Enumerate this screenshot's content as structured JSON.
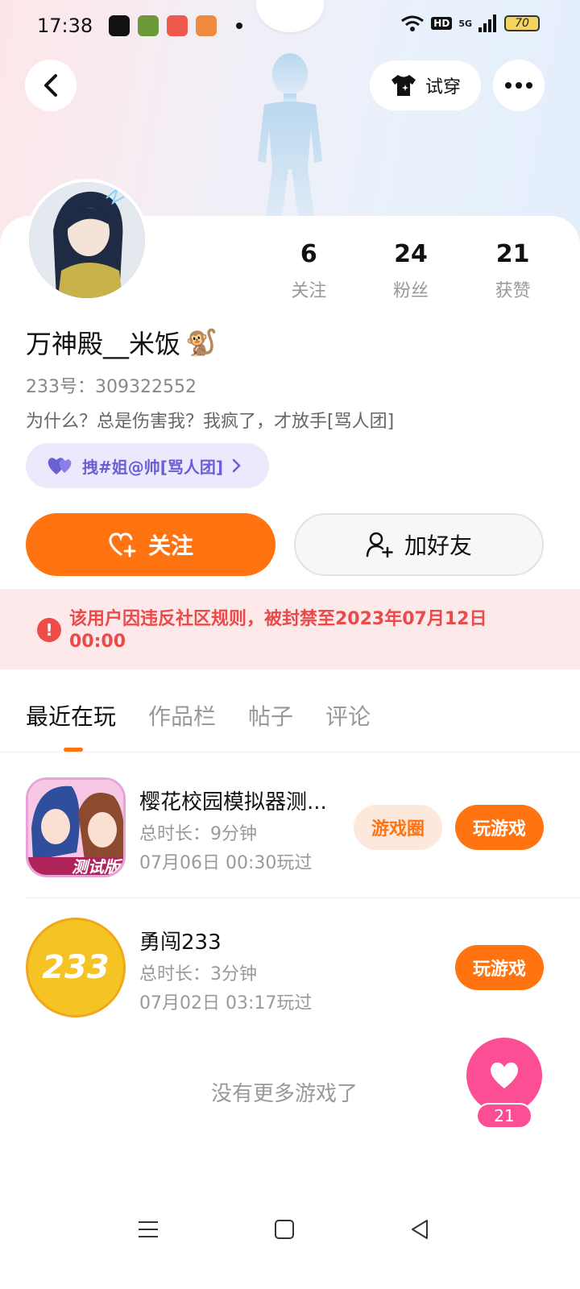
{
  "status_bar": {
    "time": "17:38",
    "hd": "HD",
    "network": "5G",
    "battery": "70"
  },
  "header": {
    "back_icon": "chevron-left-icon",
    "try_on_label": "试穿",
    "more_icon": "more-dots-icon"
  },
  "profile": {
    "stats": [
      {
        "value": "6",
        "label": "关注"
      },
      {
        "value": "24",
        "label": "粉丝"
      },
      {
        "value": "21",
        "label": "获赞"
      }
    ],
    "username": "万神殿__米饭",
    "username_emoji": "🐒",
    "uid": "233号：309322552",
    "bio": "为什么？总是伤害我？我疯了，才放手[骂人团]",
    "tag": "拽#姐@帅[骂人团]"
  },
  "actions": {
    "follow_label": "关注",
    "add_friend_label": "加好友"
  },
  "ban_notice": {
    "text": "该用户因违反社区规则，被封禁至2023年07月12日 00:00"
  },
  "tabs": [
    {
      "label": "最近在玩",
      "active": true
    },
    {
      "label": "作品栏",
      "active": false
    },
    {
      "label": "帖子",
      "active": false
    },
    {
      "label": "评论",
      "active": false
    }
  ],
  "games": [
    {
      "name": "樱花校园模拟器测...",
      "duration": "总时长：9分钟",
      "last_played": "07月06日 00:30玩过",
      "circle_label": "游戏圈",
      "play_label": "玩游戏",
      "icon_text": "测试版"
    },
    {
      "name": "勇闯233",
      "duration": "总时长：3分钟",
      "last_played": "07月02日 03:17玩过",
      "play_label": "玩游戏",
      "icon_text": "233"
    }
  ],
  "footer": {
    "no_more": "没有更多游戏了"
  },
  "like_fab": {
    "count": "21"
  },
  "colors": {
    "accent": "#ff7310",
    "like": "#fb4e94",
    "ban_bg": "#fde9e9",
    "ban_text": "#ea4a4a",
    "tag_text": "#6b5fd6"
  }
}
